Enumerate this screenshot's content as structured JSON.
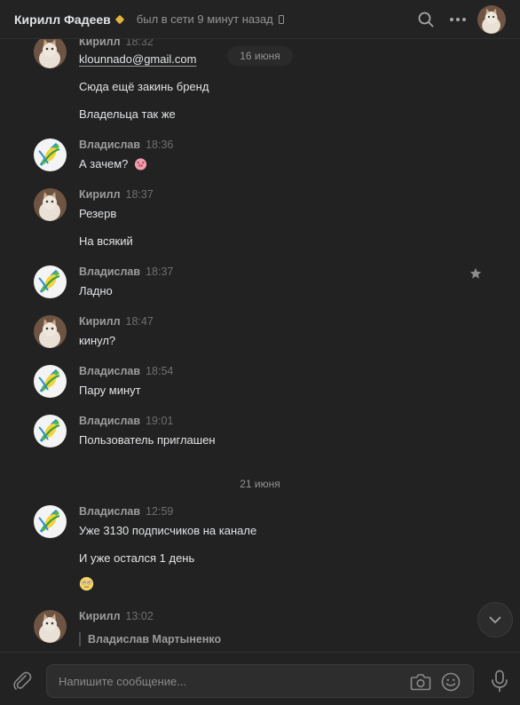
{
  "header": {
    "name": "Кирилл Фадеев",
    "status": "был в сети 9 минут назад"
  },
  "dates": {
    "first": "16 июня",
    "second": "21 июня"
  },
  "messages": [
    {
      "author": "Кирилл",
      "time": "18:32",
      "lines": [
        "klounnado@gmail.com",
        "Сюда ещё закинь бренд",
        "Владельца так же"
      ]
    },
    {
      "author": "Владислав",
      "time": "18:36",
      "lines": [
        "А зачем?"
      ]
    },
    {
      "author": "Кирилл",
      "time": "18:37",
      "lines": [
        "Резерв",
        "На всякий"
      ]
    },
    {
      "author": "Владислав",
      "time": "18:37",
      "lines": [
        "Ладно"
      ]
    },
    {
      "author": "Кирилл",
      "time": "18:47",
      "lines": [
        "кинул?"
      ]
    },
    {
      "author": "Владислав",
      "time": "18:54",
      "lines": [
        "Пару минут"
      ]
    },
    {
      "author": "Владислав",
      "time": "19:01",
      "lines": [
        "Пользователь приглашен"
      ]
    },
    {
      "author": "Владислав",
      "time": "12:59",
      "lines": [
        "Уже 3130 подписчиков на канале",
        "И уже остался 1 день"
      ]
    },
    {
      "author": "Кирилл",
      "time": "13:02",
      "reply_author": "Владислав Мартыненко"
    }
  ],
  "composer": {
    "placeholder": "Напишите сообщение..."
  },
  "colors": {
    "background": "#222222",
    "header": "#232324",
    "text": "#e1e3e6",
    "secondary": "#939393"
  }
}
